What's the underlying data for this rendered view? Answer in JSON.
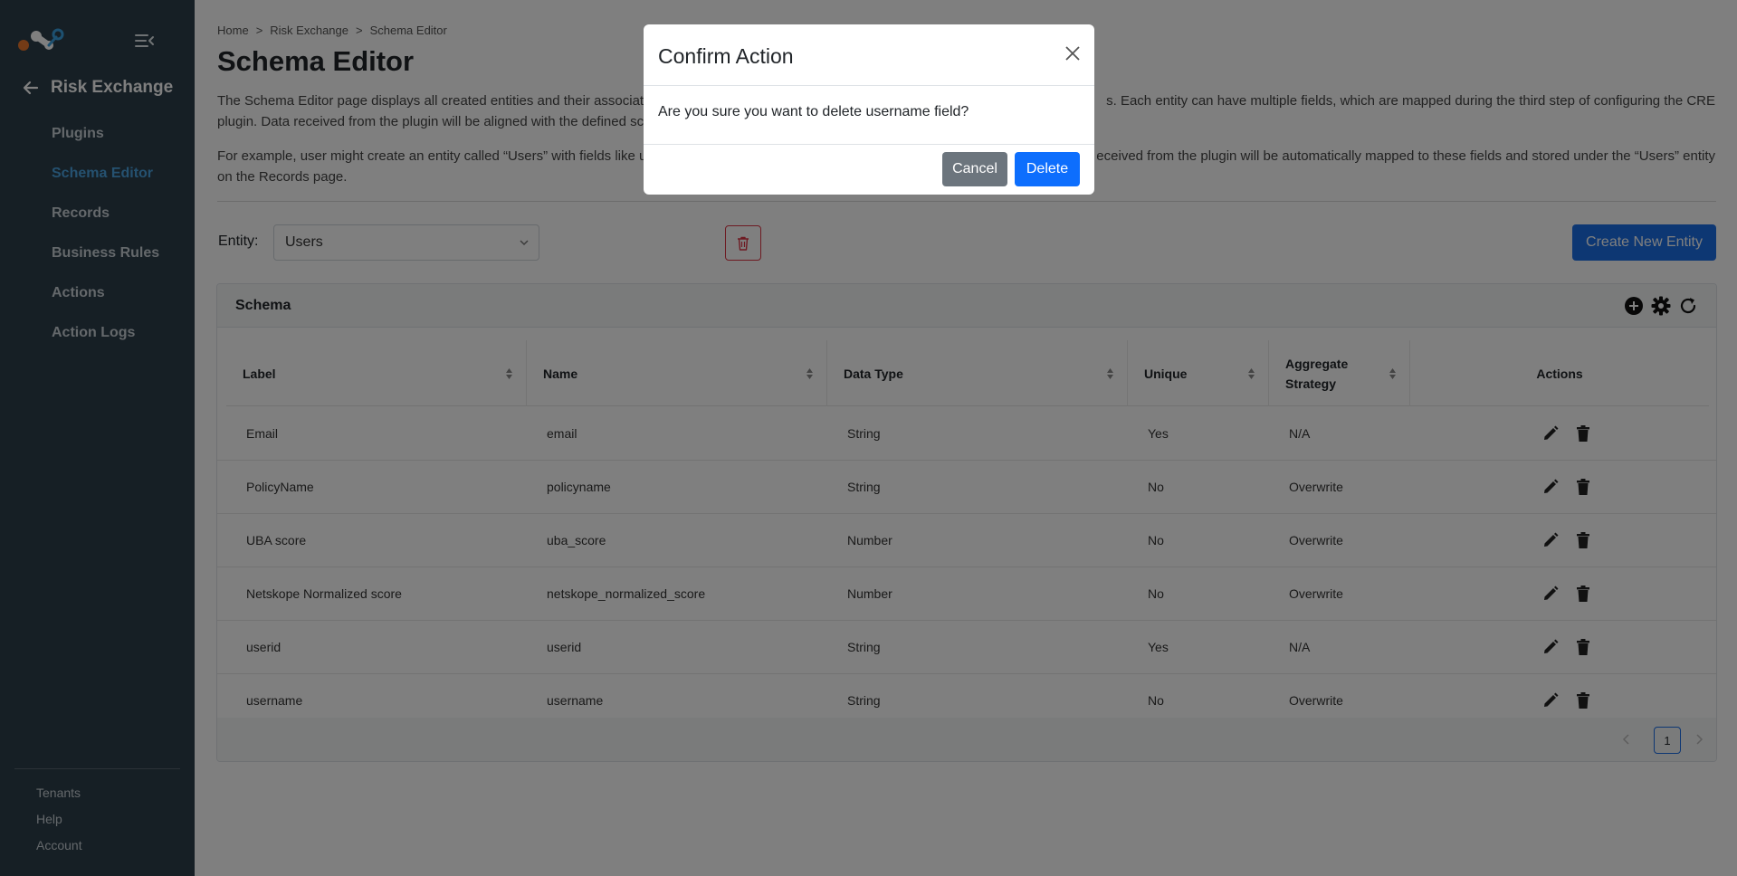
{
  "sidebar": {
    "logo_icon": "netskope-logo",
    "collapse_icon": "collapse-menu-icon",
    "section_title": "Risk Exchange",
    "items": [
      {
        "label": "Plugins",
        "active": false
      },
      {
        "label": "Schema Editor",
        "active": true
      },
      {
        "label": "Records",
        "active": false
      },
      {
        "label": "Business Rules",
        "active": false
      },
      {
        "label": "Actions",
        "active": false
      },
      {
        "label": "Action Logs",
        "active": false
      }
    ],
    "bottom_items": [
      {
        "label": "Tenants"
      },
      {
        "label": "Help"
      },
      {
        "label": "Account"
      }
    ]
  },
  "breadcrumb": {
    "items": [
      "Home",
      "Risk Exchange",
      "Schema Editor"
    ],
    "separator": ">"
  },
  "page": {
    "title": "Schema Editor",
    "desc1_left": "The Schema Editor page displays all created entities and their associat",
    "desc1_right": "s. Each entity can have multiple fields, which are mapped during the third step of configuring the CRE",
    "desc1_line2": "plugin. Data received from the plugin will be aligned with the defined sc",
    "desc2_left": "For example, user might create an entity called “Users” with fields like u",
    "desc2_right": "eceived from the plugin will be automatically mapped to these fields and stored under the “Users” entity",
    "desc2_line2": "on the Records page."
  },
  "entity": {
    "label": "Entity:",
    "selected": "Users",
    "create_button": "Create New Entity"
  },
  "schema": {
    "title": "Schema",
    "tools": [
      "add-circle-icon",
      "gear-icon",
      "refresh-icon"
    ],
    "columns": [
      "Label",
      "Name",
      "Data Type",
      "Unique",
      "Aggregate Strategy",
      "Actions"
    ],
    "rows": [
      {
        "label": "Email",
        "name": "email",
        "type": "String",
        "unique": "Yes",
        "strategy": "N/A"
      },
      {
        "label": "PolicyName",
        "name": "policyname",
        "type": "String",
        "unique": "No",
        "strategy": "Overwrite"
      },
      {
        "label": "UBA score",
        "name": "uba_score",
        "type": "Number",
        "unique": "No",
        "strategy": "Overwrite"
      },
      {
        "label": "Netskope Normalized score",
        "name": "netskope_normalized_score",
        "type": "Number",
        "unique": "No",
        "strategy": "Overwrite"
      },
      {
        "label": "userid",
        "name": "userid",
        "type": "String",
        "unique": "Yes",
        "strategy": "N/A"
      },
      {
        "label": "username",
        "name": "username",
        "type": "String",
        "unique": "No",
        "strategy": "Overwrite"
      }
    ],
    "pagination": {
      "current_page": "1"
    }
  },
  "modal": {
    "title": "Confirm Action",
    "message": "Are you sure you want to delete username field?",
    "cancel": "Cancel",
    "delete": "Delete"
  },
  "colors": {
    "sidebar_bg": "#2d3e4a",
    "active_nav": "#4aa3e0",
    "primary": "#1a6ee6",
    "danger": "#dc3545",
    "cancel_btn": "#6c757d"
  }
}
